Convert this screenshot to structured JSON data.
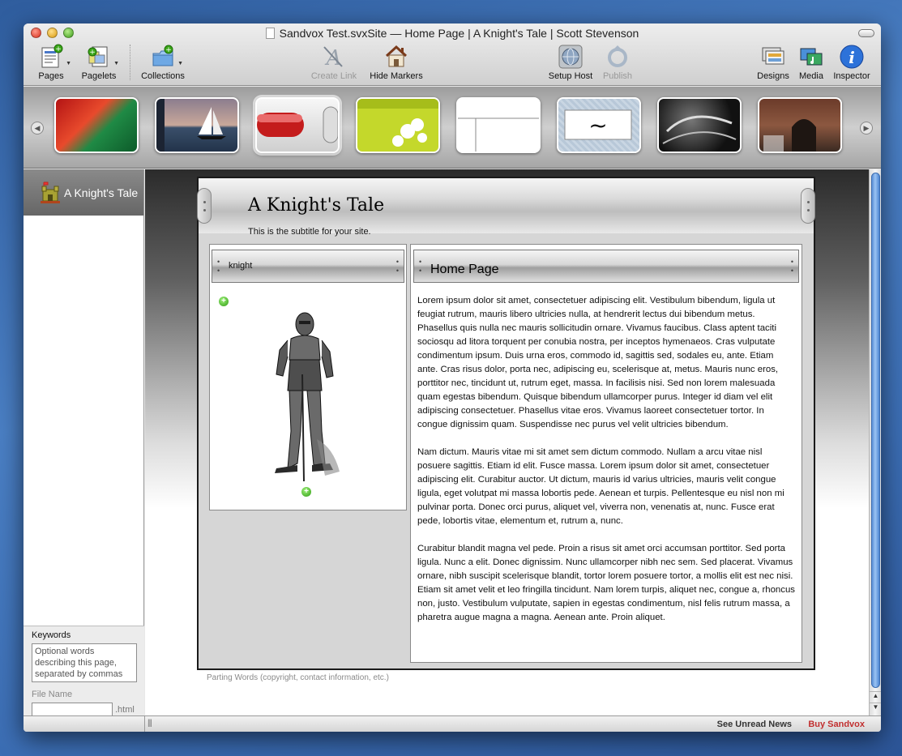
{
  "window": {
    "title": "Sandvox Test.svxSite — Home Page | A Knight's Tale | Scott Stevenson"
  },
  "toolbar": {
    "pages": "Pages",
    "pagelets": "Pagelets",
    "collections": "Collections",
    "create_link": "Create Link",
    "hide_markers": "Hide Markers",
    "setup_host": "Setup Host",
    "publish": "Publish",
    "designs": "Designs",
    "media": "Media",
    "inspector": "Inspector"
  },
  "design_strip": {
    "thumbnails": [
      "red-flower",
      "sailboat-sunset",
      "red-pill-button",
      "green-white-flowers",
      "white-blank",
      "tilde-box",
      "dark-abstract",
      "brick-arch"
    ],
    "selected_index": 2
  },
  "sidebar": {
    "site_name": "A Knight's Tale",
    "keywords_label": "Keywords",
    "keywords_placeholder": "Optional words describing this page, separated by commas",
    "filename_label": "File Name",
    "filename_value": "",
    "filename_ext": ".html"
  },
  "page": {
    "title": "A Knight's Tale",
    "subtitle": "This is the subtitle for your site.",
    "pagelet_title": "knight",
    "heading": "Home Page",
    "paragraphs": [
      "Lorem ipsum dolor sit amet, consectetuer adipiscing elit. Vestibulum bibendum, ligula ut feugiat rutrum, mauris libero ultricies nulla, at hendrerit lectus dui bibendum metus. Phasellus quis nulla nec mauris sollicitudin ornare. Vivamus faucibus. Class aptent taciti sociosqu ad litora torquent per conubia nostra, per inceptos hymenaeos. Cras vulputate condimentum ipsum. Duis urna eros, commodo id, sagittis sed, sodales eu, ante. Etiam ante. Cras risus dolor, porta nec, adipiscing eu, scelerisque at, metus. Mauris nunc eros, porttitor nec, tincidunt ut, rutrum eget, massa. In facilisis nisi. Sed non lorem malesuada quam egestas bibendum. Quisque bibendum ullamcorper purus. Integer id diam vel elit adipiscing consectetuer. Phasellus vitae eros. Vivamus laoreet consectetuer tortor. In congue dignissim quam. Suspendisse nec purus vel velit ultricies bibendum.",
      "Nam dictum. Mauris vitae mi sit amet sem dictum commodo. Nullam a arcu vitae nisl posuere sagittis. Etiam id elit. Fusce massa. Lorem ipsum dolor sit amet, consectetuer adipiscing elit. Curabitur auctor. Ut dictum, mauris id varius ultricies, mauris velit congue ligula, eget volutpat mi massa lobortis pede. Aenean et turpis. Pellentesque eu nisl non mi pulvinar porta. Donec orci purus, aliquet vel, viverra non, venenatis at, nunc. Fusce erat pede, lobortis vitae, elementum et, rutrum a, nunc.",
      "Curabitur blandit magna vel pede. Proin a risus sit amet orci accumsan porttitor. Sed porta ligula. Nunc a elit. Donec dignissim. Nunc ullamcorper nibh nec sem. Sed placerat. Vivamus ornare, nibh suscipit scelerisque blandit, tortor lorem posuere tortor, a mollis elit est nec nisi. Etiam sit amet velit et leo fringilla tincidunt. Nam lorem turpis, aliquet nec, congue a, rhoncus non, justo. Vestibulum vulputate, sapien in egestas condimentum, nisl felis rutrum massa, a pharetra augue magna a magna. Aenean ante. Proin aliquet."
    ],
    "footer": "Parting Words (copyright, contact information, etc.)"
  },
  "statusbar": {
    "news": "See Unread News",
    "buy": "Buy Sandvox"
  },
  "colors": {
    "buy_link": "#c12f2f",
    "accent_scroll": "#5a8fd6"
  }
}
